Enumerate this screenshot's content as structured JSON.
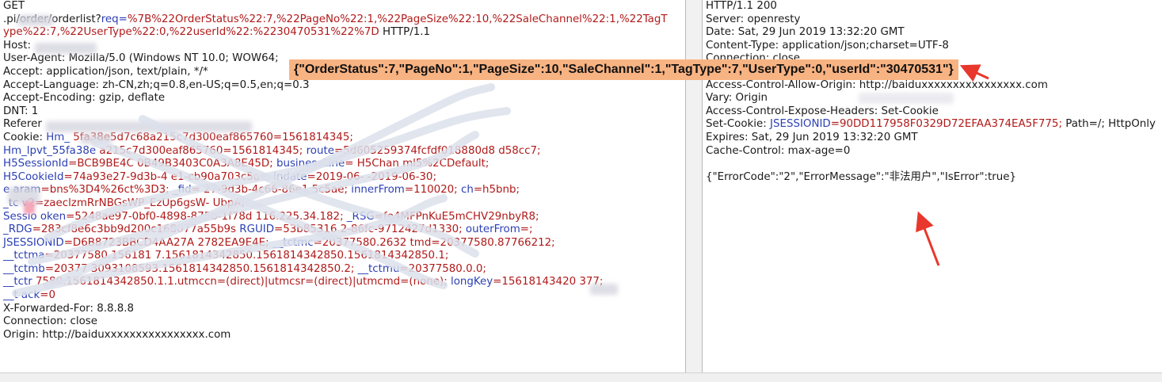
{
  "request": {
    "lines": [
      [
        {
          "t": "GET",
          "c": "dark"
        }
      ],
      [
        {
          "t": "      .pi/order/orderlist?",
          "c": "dark"
        },
        {
          "t": "req=",
          "c": "blue"
        },
        {
          "t": "%7B%22OrderStatus%22:7,%22PageNo%22:1,%22PageSize%22:10,%22SaleChannel%22:1,%22TagT",
          "c": "red"
        }
      ],
      [
        {
          "t": "ype%22:7,%22UserType%22:0,%22userId%22:%2230470531%22%7D",
          "c": "red"
        },
        {
          "t": " HTTP/1.1",
          "c": "dark"
        }
      ],
      [
        {
          "t": "Host:",
          "c": "dark"
        }
      ],
      [
        {
          "t": "User-Agent: Mozilla/5.0 (Windows NT 10.0; WOW64;",
          "c": "dark"
        }
      ],
      [
        {
          "t": "Accept: application/json, text/plain, */*",
          "c": "dark"
        }
      ],
      [
        {
          "t": "Accept-Language: zh-CN,zh;q=0.8,en-US;q=0.5,en;q=0.3",
          "c": "dark"
        }
      ],
      [
        {
          "t": "Accept-Encoding: gzip, deflate",
          "c": "dark"
        }
      ],
      [
        {
          "t": "DNT: 1",
          "c": "dark"
        }
      ],
      [
        {
          "t": "Referer",
          "c": "dark"
        }
      ],
      [
        {
          "t": "Cookie: ",
          "c": "dark"
        },
        {
          "t": "Hm_",
          "c": "blue"
        },
        {
          "t": "      5fa38e5d7c68a215c7d300eaf865760=1561814345;",
          "c": "red"
        }
      ],
      [
        {
          "t": "Hm_lpvt_55fa38e",
          "c": "blue"
        },
        {
          "t": "        a215c7d300eaf865760=1561814345;",
          "c": "red"
        },
        {
          "t": " route",
          "c": "blue"
        },
        {
          "t": "=5d605259374fcfdf018880d8    d58cc7;",
          "c": "red"
        }
      ],
      [
        {
          "t": "H5SessionId",
          "c": "blue"
        },
        {
          "t": "=BCB9BE4C        0B49B3403C0A3A8E45D;",
          "c": "red"
        },
        {
          "t": " businessLine",
          "c": "blue"
        },
        {
          "t": "=      H5Chan          ml5%2CDefault;",
          "c": "red"
        }
      ],
      [
        {
          "t": "H5CookieId",
          "c": "blue"
        },
        {
          "t": "=74a93e27-9d3b-4        e1-cb90a703c5ae;",
          "c": "red"
        },
        {
          "t": " indate",
          "c": "blue"
        },
        {
          "t": "=2019-06-            -2019-06-30;",
          "c": "red"
        }
      ],
      [
        {
          "t": "e    aram",
          "c": "blue"
        },
        {
          "t": "=bns%3D4%26ct%3D3;",
          "c": "red"
        },
        {
          "t": " _fid",
          "c": "blue"
        },
        {
          "t": "=       27-9d3b-4c66-86e1         5c5ae;",
          "c": "red"
        },
        {
          "t": " innerFrom",
          "c": "blue"
        },
        {
          "t": "=110020;",
          "c": "red"
        },
        {
          "t": " ch",
          "c": "blue"
        },
        {
          "t": "=h5bnb;",
          "c": "red"
        }
      ],
      [
        {
          "t": "_tc     v2",
          "c": "blue"
        },
        {
          "t": "=zaeclzmRrNBGsWP_EzUp6gsW-              UbpA;",
          "c": "red"
        }
      ],
      [
        {
          "t": "Sessio  oken",
          "c": "blue"
        },
        {
          "t": "=5248ae97-0bf0-4898-875b-1f78d          116.225.34.182;",
          "c": "red"
        },
        {
          "t": " _RSG",
          "c": "blue"
        },
        {
          "t": "=fe4MFPnKuE5mCHV29nbyR8;",
          "c": "red"
        }
      ],
      [
        {
          "t": "_RDG",
          "c": "blue"
        },
        {
          "t": "=283cf8e6c3bb9d200c168077a55b9s     ",
          "c": "red"
        },
        {
          "t": "  RGUID",
          "c": "blue"
        },
        {
          "t": "=53b85316        2-86fc-9712427d1330;",
          "c": "red"
        },
        {
          "t": " outerFrom",
          "c": "blue"
        },
        {
          "t": "=;",
          "c": "red"
        }
      ],
      [
        {
          "t": "JSESSIONID",
          "c": "blue"
        },
        {
          "t": "=D6B8723BBCD4AA27A      2782EA9E4E;",
          "c": "red"
        },
        {
          "t": " __tctmc",
          "c": "blue"
        },
        {
          "t": "=20377580.2632      tmd=20377580.87766212;",
          "c": "red"
        }
      ],
      [
        {
          "t": "__tctma",
          "c": "blue"
        },
        {
          "t": "=20377580.156181        7.1561814342850.1561814342850.1561814342850.1;",
          "c": "red"
        }
      ],
      [
        {
          "t": "__tctmb",
          "c": "blue"
        },
        {
          "t": "=20377        3093108593.1561814342850.1561814342850.2;",
          "c": "red"
        },
        {
          "t": " __tctmu",
          "c": "blue"
        },
        {
          "t": "=20377580.0.0;",
          "c": "red"
        }
      ],
      [
        {
          "t": "__tctr",
          "c": "blue"
        },
        {
          "t": "      7580.1561814342850.1.1.utmccn=(direct)|utmcsr=(direct)|utmcmd=(none);",
          "c": "red"
        },
        {
          "t": " longKey",
          "c": "blue"
        },
        {
          "t": "=15618143420      377;",
          "c": "red"
        }
      ],
      [
        {
          "t": "__t    ack",
          "c": "blue"
        },
        {
          "t": "=0",
          "c": "red"
        }
      ],
      [
        {
          "t": "X-Forwarded-For: 8.8.8.8",
          "c": "dark"
        }
      ],
      [
        {
          "t": "Connection: close",
          "c": "dark"
        }
      ],
      [
        {
          "t": "Origin: http://baiduxxxxxxxxxxxxxxxx.com",
          "c": "dark"
        }
      ]
    ]
  },
  "response": {
    "lines": [
      [
        {
          "t": "HTTP/1.1 200",
          "c": "dark"
        }
      ],
      [
        {
          "t": "Server: openresty",
          "c": "dark"
        }
      ],
      [
        {
          "t": "Date: Sat, 29 Jun 2019 13:32:20 GMT",
          "c": "dark"
        }
      ],
      [
        {
          "t": "Content-Type: application/json;charset=UTF-8",
          "c": "dark"
        }
      ],
      [
        {
          "t": "Connection: close",
          "c": "dark"
        }
      ],
      [
        {
          "t": "Access-Control-Allow-Credentials: true",
          "c": "dark"
        }
      ],
      [
        {
          "t": "Access-Control-Allow-Origin: http://baiduxxxxxxxxxxxxxxxx.com",
          "c": "dark"
        }
      ],
      [
        {
          "t": "Vary: Origin",
          "c": "dark"
        }
      ],
      [
        {
          "t": "Access-Control-Expose-Headers: Set-Cookie",
          "c": "dark"
        }
      ],
      [
        {
          "t": "Set-Cookie: ",
          "c": "dark"
        },
        {
          "t": "JSESSIONID",
          "c": "blue"
        },
        {
          "t": "=90DD117958F0329D72EFAA374EA5F775;",
          "c": "red"
        },
        {
          "t": " Path=/; HttpOnly",
          "c": "dark"
        }
      ],
      [
        {
          "t": "Expires: Sat, 29 Jun 2019 13:32:20 GMT",
          "c": "dark"
        }
      ],
      [
        {
          "t": "Cache-Control: max-age=0",
          "c": "dark"
        }
      ],
      [
        {
          "t": "",
          "c": "dark"
        }
      ],
      [
        {
          "t": "{\"ErrorCode\":\"2\",\"ErrorMessage\":\"非法用户\",\"IsError\":true}",
          "c": "dark"
        }
      ]
    ]
  },
  "callout": {
    "text": "{\"OrderStatus\":7,\"PageNo\":1,\"PageSize\":10,\"SaleChannel\":1,\"TagType\":7,\"UserType\":0,\"userId\":\"30470531\"}",
    "color": "#f8b382"
  },
  "colors": {
    "key": "#2b3fb3",
    "value": "#b11a1a",
    "arrow": "#e8372c"
  }
}
